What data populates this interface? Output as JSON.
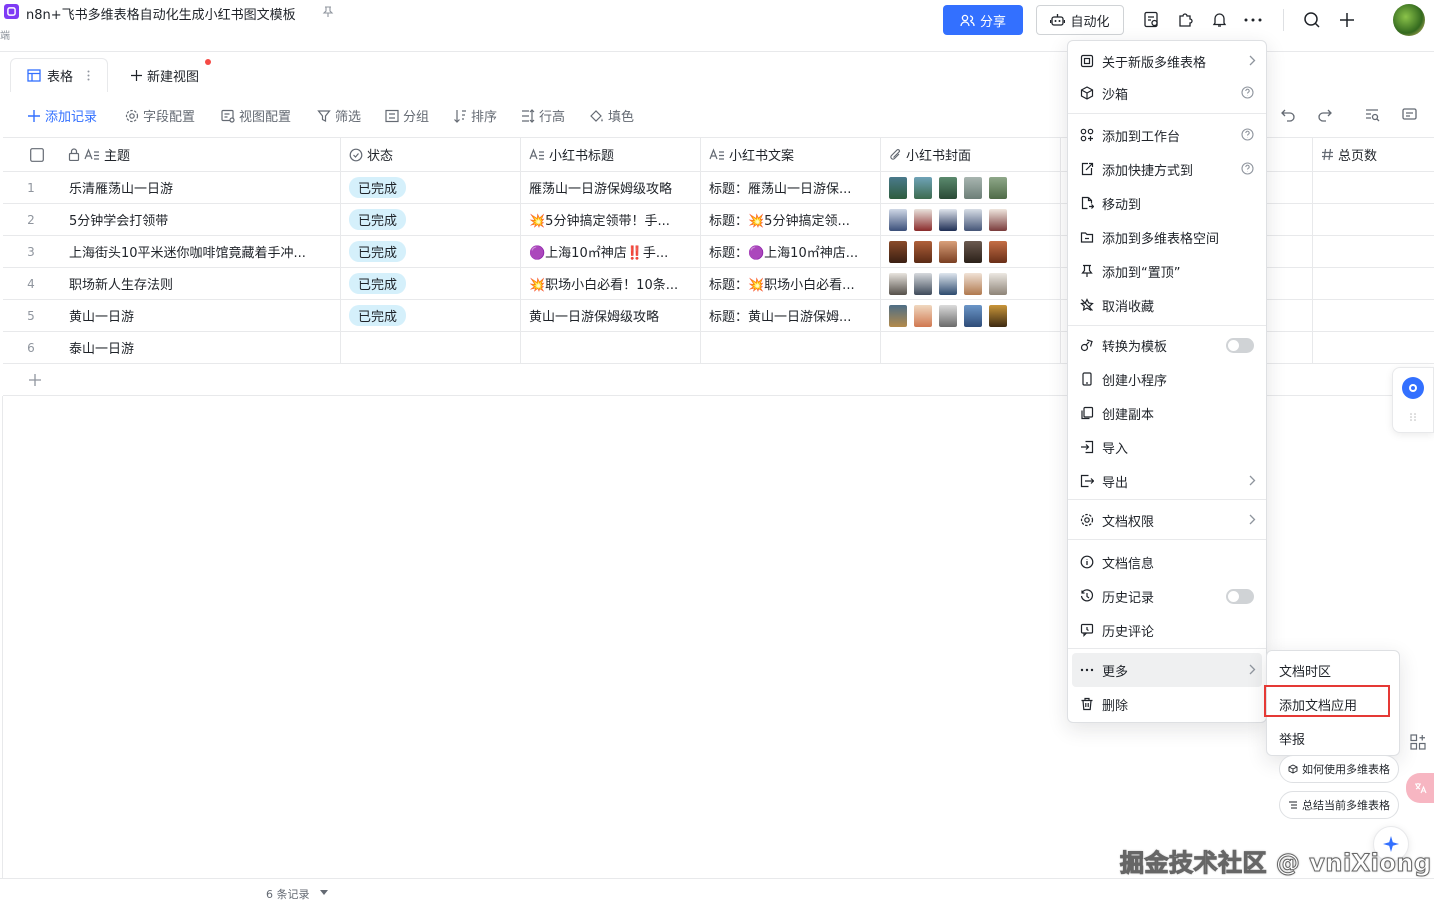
{
  "header": {
    "doc_title": "n8n+飞书多维表格自动化生成小红书图文模板",
    "sub_tag": "端",
    "share_label": "分享",
    "automation_label": "自动化"
  },
  "tabs": {
    "active_label": "表格",
    "new_view_label": "新建视图"
  },
  "toolbar": {
    "add_record": "添加记录",
    "field_config": "字段配置",
    "view_config": "视图配置",
    "filter": "筛选",
    "group": "分组",
    "sort": "排序",
    "row_height": "行高",
    "fill_color": "填色"
  },
  "table": {
    "headers": {
      "subject": "主题",
      "status": "状态",
      "title": "小红书标题",
      "copy": "小红书文案",
      "cover": "小红书封面",
      "pages": "总页数"
    },
    "rows": [
      {
        "num": "1",
        "subject": "乐清雁荡山一日游",
        "status": "已完成",
        "title": "雁荡山一日游保姆级攻略",
        "copy": "标题：雁荡山一日游保..."
      },
      {
        "num": "2",
        "subject": "5分钟学会打领带",
        "status": "已完成",
        "title": "💥5分钟搞定领带！手...",
        "copy": "标题：💥5分钟搞定领..."
      },
      {
        "num": "3",
        "subject": "上海街头10平米迷你咖啡馆竟藏着手冲...",
        "status": "已完成",
        "title": "🟣上海10㎡神店‼️手...",
        "copy": "标题：🟣上海10㎡神店..."
      },
      {
        "num": "4",
        "subject": "职场新人生存法则",
        "status": "已完成",
        "title": "💥职场小白必看！10条...",
        "copy": "标题：💥职场小白必看..."
      },
      {
        "num": "5",
        "subject": "黄山一日游",
        "status": "已完成",
        "title": "黄山一日游保姆级攻略",
        "copy": "标题：黄山一日游保姆..."
      },
      {
        "num": "6",
        "subject": "泰山一日游",
        "status": "",
        "title": "",
        "copy": ""
      }
    ],
    "footer_count": "6 条记录"
  },
  "menu": {
    "items": [
      {
        "label": "关于新版多维表格"
      },
      {
        "label": "沙箱"
      },
      {
        "label": "添加到工作台"
      },
      {
        "label": "添加快捷方式到"
      },
      {
        "label": "移动到"
      },
      {
        "label": "添加到多维表格空间"
      },
      {
        "label": "添加到“置顶”"
      },
      {
        "label": "取消收藏"
      },
      {
        "label": "转换为模板"
      },
      {
        "label": "创建小程序"
      },
      {
        "label": "创建副本"
      },
      {
        "label": "导入"
      },
      {
        "label": "导出"
      },
      {
        "label": "文档权限"
      },
      {
        "label": "文档信息"
      },
      {
        "label": "历史记录"
      },
      {
        "label": "历史评论"
      },
      {
        "label": "更多"
      },
      {
        "label": "删除"
      }
    ]
  },
  "submenu": {
    "items": [
      {
        "label": "文档时区"
      },
      {
        "label": "添加文档应用"
      },
      {
        "label": "举报"
      }
    ]
  },
  "assistant": {
    "how_to_use": "如何使用多维表格",
    "summarize": "总结当前多维表格"
  },
  "watermark": "掘金技术社区 @ vniXiong",
  "colors": {
    "accent": "#3370ff",
    "status_bg": "#d5f0fb",
    "highlight": "#e53935"
  }
}
